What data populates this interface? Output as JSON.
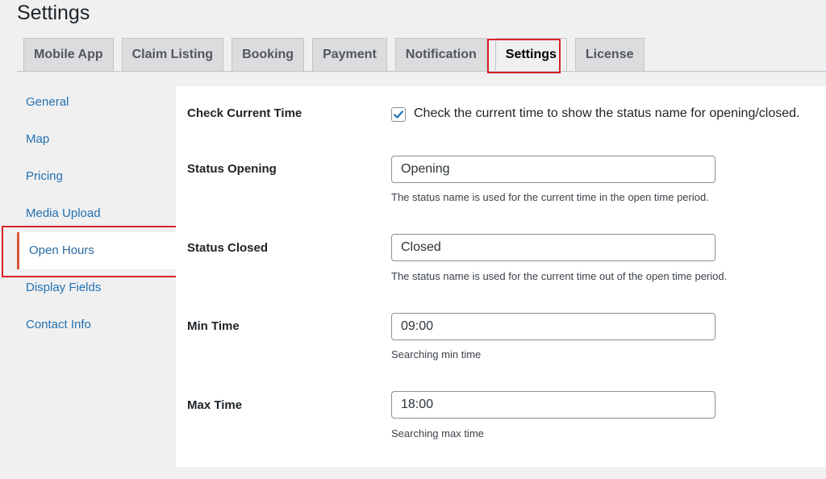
{
  "page": {
    "title": "Settings"
  },
  "tabs": [
    {
      "label": "Mobile App",
      "active": false
    },
    {
      "label": "Claim Listing",
      "active": false
    },
    {
      "label": "Booking",
      "active": false
    },
    {
      "label": "Payment",
      "active": false
    },
    {
      "label": "Notification",
      "active": false
    },
    {
      "label": "Settings",
      "active": true
    },
    {
      "label": "License",
      "active": false
    }
  ],
  "sidebar": {
    "items": [
      {
        "label": "General",
        "active": false
      },
      {
        "label": "Map",
        "active": false
      },
      {
        "label": "Pricing",
        "active": false
      },
      {
        "label": "Media Upload",
        "active": false
      },
      {
        "label": "Open Hours",
        "active": true
      },
      {
        "label": "Display Fields",
        "active": false
      },
      {
        "label": "Contact Info",
        "active": false
      }
    ]
  },
  "form": {
    "check_current_time": {
      "label": "Check Current Time",
      "checked": true,
      "checkbox_text": "Check the current time to show the status name for opening/closed."
    },
    "status_opening": {
      "label": "Status Opening",
      "value": "Opening",
      "description": "The status name is used for the current time in the open time period."
    },
    "status_closed": {
      "label": "Status Closed",
      "value": "Closed",
      "description": "The status name is used for the current time out of the open time period."
    },
    "min_time": {
      "label": "Min Time",
      "value": "09:00",
      "description": "Searching min time"
    },
    "max_time": {
      "label": "Max Time",
      "value": "18:00",
      "description": "Searching max time"
    }
  },
  "colors": {
    "link": "#2271b1",
    "highlight": "#d8232a",
    "active_marker": "#d6573a",
    "checkbox_check": "#2271b1"
  },
  "icons": {
    "checkbox": "checkmark-icon"
  }
}
